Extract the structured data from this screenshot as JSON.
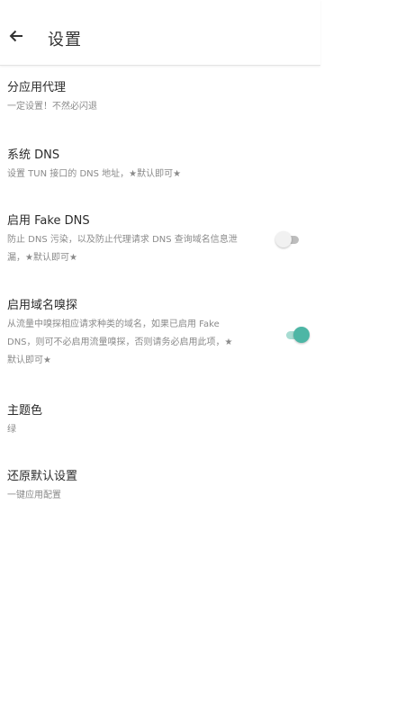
{
  "appbar": {
    "title": "设置"
  },
  "settings": [
    {
      "title": "分应用代理",
      "summary_lines": [
        "一定设置！不然必闪退"
      ]
    },
    {
      "title": "系统 DNS",
      "summary_lines": [
        "设置 TUN 接口的 DNS 地址，★默认即可★"
      ]
    },
    {
      "title": "启用 Fake DNS",
      "summary_lines": [
        "防止 DNS 污染，以及防止代理请求 DNS 查询域名信息泄",
        "漏，★默认即可★"
      ],
      "toggle_state": "off"
    },
    {
      "title": "启用域名嗅探",
      "summary_lines": [
        "从流量中嗅探相应请求种类的域名，如果已启用 Fake",
        "DNS，则可不必启用流量嗅探，否则请务必启用此项，★",
        "默认即可★"
      ],
      "toggle_state": "on"
    },
    {
      "title": "主题色",
      "summary_lines": [
        "绿"
      ]
    },
    {
      "title": "还原默认设置",
      "summary_lines": [
        "一键应用配置"
      ]
    }
  ],
  "colors": {
    "accent": "#4db6a5",
    "accent_track": "#a7dcd2",
    "toggle_off_thumb": "#f1f1f1",
    "toggle_off_track": "#bdbdbd"
  }
}
